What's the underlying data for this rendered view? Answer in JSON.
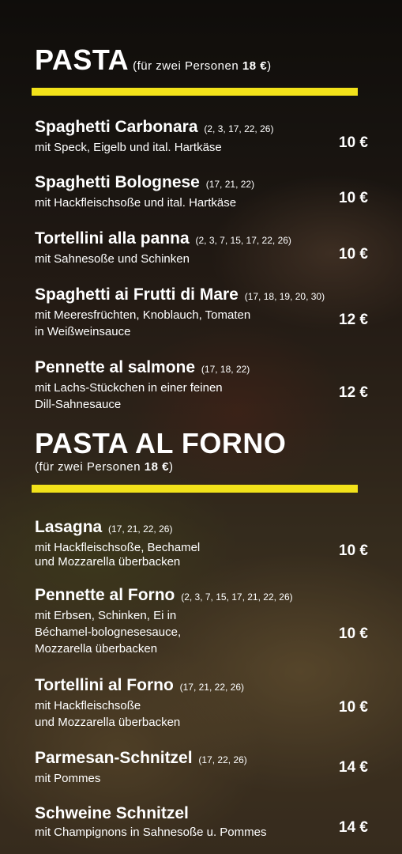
{
  "sections": [
    {
      "title": "PASTA",
      "note_prefix": "(für zwei Personen ",
      "note_price": "18 €",
      "note_suffix": ")",
      "items": [
        {
          "name": "Spaghetti Carbonara",
          "allergens": "(2, 3, 17, 22, 26)",
          "desc": [
            "mit Speck, Eigelb und ital. Hartkäse"
          ],
          "price": "10 €"
        },
        {
          "name": "Spaghetti Bolognese",
          "allergens": "(17, 21, 22)",
          "desc": [
            "mit Hackfleischsoße und ital. Hartkäse"
          ],
          "price": "10 €"
        },
        {
          "name": "Tortellini alla panna",
          "allergens": "(2, 3, 7, 15, 17, 22, 26)",
          "desc": [
            "mit Sahnesoße und Schinken"
          ],
          "price": "10 €"
        },
        {
          "name": "Spaghetti ai Frutti di Mare",
          "allergens": "(17, 18, 19, 20, 30)",
          "desc": [
            "mit Meeresfrüchten, Knoblauch, Tomaten",
            "in Weißweinsauce"
          ],
          "price": "12 €"
        },
        {
          "name": "Pennette al salmone",
          "allergens": "(17, 18, 22)",
          "desc": [
            "mit Lachs-Stückchen in einer feinen",
            "Dill-Sahnesauce"
          ],
          "price": "12 €"
        }
      ]
    },
    {
      "title": "PASTA AL FORNO",
      "note_prefix": "(für zwei Personen ",
      "note_price": "18 €",
      "note_suffix": ")",
      "items": [
        {
          "name": "Lasagna",
          "allergens": "(17, 21, 22, 26)",
          "desc": [
            "mit Hackfleischsoße, Bechamel",
            "und Mozzarella überbacken"
          ],
          "price": "10 €"
        },
        {
          "name": "Pennette al Forno",
          "allergens": "(2, 3, 7, 15, 17, 21, 22, 26)",
          "desc": [
            "mit Erbsen, Schinken, Ei in",
            "Béchamel-bolognesesauce,",
            "Mozzarella überbacken"
          ],
          "price": "10 €"
        },
        {
          "name": "Tortellini al Forno",
          "allergens": "(17, 21, 22, 26)",
          "desc": [
            "mit Hackfleischsoße",
            "und Mozzarella überbacken"
          ],
          "price": "10 €"
        },
        {
          "name": "Parmesan-Schnitzel",
          "allergens": "(17, 22, 26)",
          "desc": [
            "mit Pommes"
          ],
          "price": "14 €"
        },
        {
          "name": "Schweine Schnitzel",
          "allergens": "",
          "desc": [
            "mit Champignons in Sahnesoße u. Pommes"
          ],
          "price": "14 €"
        }
      ]
    }
  ],
  "colors": {
    "accent_bar": "#f2e21a",
    "text": "#ffffff"
  }
}
